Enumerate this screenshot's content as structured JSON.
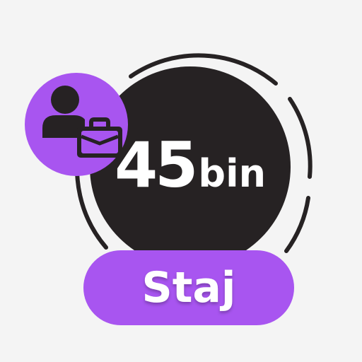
{
  "badge": {
    "icon": "person-with-briefcase-icon",
    "color": "#a855f0"
  },
  "count": {
    "number": "45",
    "unit": "bin"
  },
  "category": {
    "label": "Staj"
  },
  "colors": {
    "background": "#f4f4f4",
    "disc": "#262223",
    "accent": "#a855f0",
    "text": "#ffffff"
  }
}
